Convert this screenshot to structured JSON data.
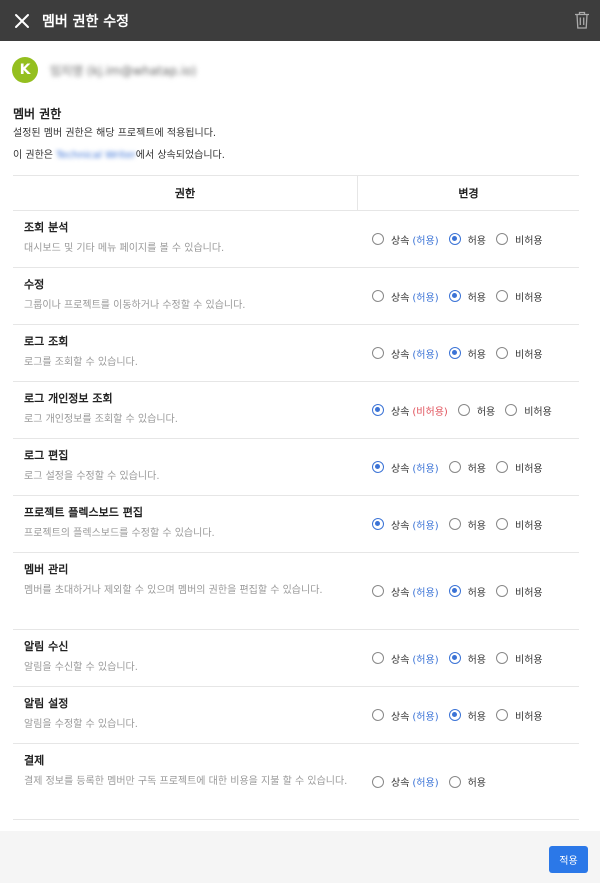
{
  "header": {
    "title": "멤버 권한 수정"
  },
  "user": {
    "initial": "K",
    "name": "임지영 (kj.im@whatap.io)"
  },
  "section": {
    "title": "멤버 권한",
    "desc1": "설정된 멤버 권한은 해당 프로젝트에 적용됩니다.",
    "desc2_prefix": "이 권한은 ",
    "desc2_link": "Technical Writer",
    "desc2_suffix": "에서 상속되었습니다."
  },
  "table": {
    "col_permission": "권한",
    "col_change": "변경",
    "rows": [
      {
        "name": "조회 분석",
        "desc": "대시보드 및 기타 메뉴 페이지를 볼 수 있습니다.",
        "inherit_label": "상속",
        "inherit_value": "(허용)",
        "inherit_type": "allow",
        "allow_label": "허용",
        "deny_label": "비허용",
        "selected": "allow"
      },
      {
        "name": "수정",
        "desc": "그룹이나 프로젝트를 이동하거나 수정할 수 있습니다.",
        "inherit_label": "상속",
        "inherit_value": "(허용)",
        "inherit_type": "allow",
        "allow_label": "허용",
        "deny_label": "비허용",
        "selected": "allow"
      },
      {
        "name": "로그 조회",
        "desc": "로그를 조회할 수 있습니다.",
        "inherit_label": "상속",
        "inherit_value": "(허용)",
        "inherit_type": "allow",
        "allow_label": "허용",
        "deny_label": "비허용",
        "selected": "allow"
      },
      {
        "name": "로그 개인정보 조회",
        "desc": "로그 개인정보를 조회할 수 있습니다.",
        "inherit_label": "상속",
        "inherit_value": "(비허용)",
        "inherit_type": "deny",
        "allow_label": "허용",
        "deny_label": "비허용",
        "selected": "inherit"
      },
      {
        "name": "로그 편집",
        "desc": "로그 설정을 수정할 수 있습니다.",
        "inherit_label": "상속",
        "inherit_value": "(허용)",
        "inherit_type": "allow",
        "allow_label": "허용",
        "deny_label": "비허용",
        "selected": "inherit"
      },
      {
        "name": "프로젝트 플렉스보드 편집",
        "desc": "프로젝트의 플렉스보드를 수정할 수 있습니다.",
        "inherit_label": "상속",
        "inherit_value": "(허용)",
        "inherit_type": "allow",
        "allow_label": "허용",
        "deny_label": "비허용",
        "selected": "inherit"
      },
      {
        "name": "멤버 관리",
        "desc": "멤버를 초대하거나 제외할 수 있으며 멤버의 권한을 편집할 수 있습니다.",
        "inherit_label": "상속",
        "inherit_value": "(허용)",
        "inherit_type": "allow",
        "allow_label": "허용",
        "deny_label": "비허용",
        "selected": "allow"
      },
      {
        "name": "알림 수신",
        "desc": "알림을 수신할 수 있습니다.",
        "inherit_label": "상속",
        "inherit_value": "(허용)",
        "inherit_type": "allow",
        "allow_label": "허용",
        "deny_label": "비허용",
        "selected": "allow"
      },
      {
        "name": "알림 설정",
        "desc": "알림을 수정할 수 있습니다.",
        "inherit_label": "상속",
        "inherit_value": "(허용)",
        "inherit_type": "allow",
        "allow_label": "허용",
        "deny_label": "비허용",
        "selected": "allow"
      },
      {
        "name": "결제",
        "desc": "결제 정보를 등록한 멤버만 구독 프로젝트에 대한 비용을 지불 할 수 있습니다.",
        "inherit_label": "상속",
        "inherit_value": "(허용)",
        "inherit_type": "allow",
        "allow_label": "허용",
        "deny_label": "",
        "selected": "none"
      }
    ]
  },
  "footer": {
    "apply_label": "적용"
  },
  "colors": {
    "header_bg": "#3d3d3d",
    "accent": "#2b78e8",
    "allow": "#3b73d6",
    "deny": "#e0505a",
    "avatar": "#94bf1f"
  },
  "icons": {
    "close": "close-icon",
    "trash": "trash-icon"
  }
}
